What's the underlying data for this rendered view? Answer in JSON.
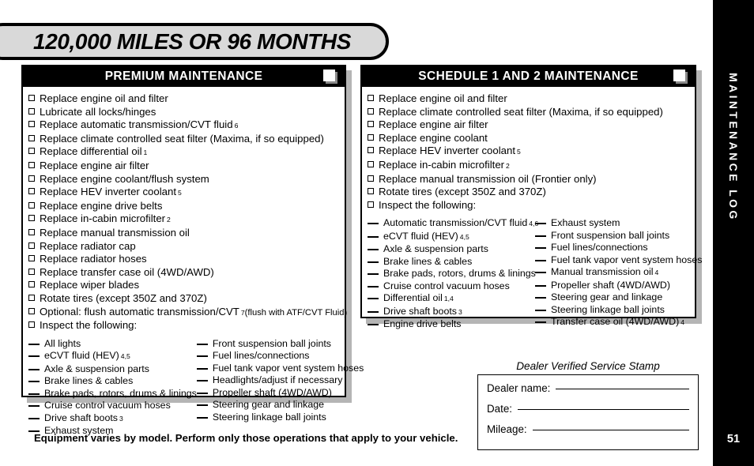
{
  "banner": {
    "title": "120,000 MILES OR 96 MONTHS"
  },
  "side_tab": {
    "label": "MAINTENANCE LOG",
    "page_number": "51"
  },
  "footer": {
    "note": "Equipment varies by model. Perform only those operations that apply to your vehicle."
  },
  "panels": {
    "premium": {
      "header": "PREMIUM MAINTENANCE",
      "icon": "page-icon",
      "items": [
        {
          "text": "Replace engine oil and filter"
        },
        {
          "text": "Lubricate all locks/hinges"
        },
        {
          "text": "Replace automatic transmission/CVT fluid",
          "sup": "6"
        },
        {
          "text": "Replace climate controlled seat filter (Maxima, if so equipped)"
        },
        {
          "text": "Replace differential oil",
          "sup": "1"
        },
        {
          "text": "Replace engine air filter"
        },
        {
          "text": "Replace engine coolant/flush system"
        },
        {
          "text": "Replace HEV inverter coolant",
          "sup": "5"
        },
        {
          "text": "Replace engine drive belts"
        },
        {
          "text": "Replace in-cabin microfilter",
          "sup": "2"
        },
        {
          "text": "Replace manual transmission oil"
        },
        {
          "text": "Replace radiator cap"
        },
        {
          "text": "Replace radiator hoses"
        },
        {
          "text": "Replace transfer case oil (4WD/AWD)"
        },
        {
          "text": "Replace wiper blades"
        },
        {
          "text": "Rotate tires (except 350Z and 370Z)"
        },
        {
          "text": "Optional: flush automatic transmission/CVT",
          "sup": "7",
          "note": "(flush with ATF/CVT Fluid)"
        },
        {
          "text": "Inspect the following:"
        }
      ],
      "inspect_col_1": [
        {
          "text": "All lights"
        },
        {
          "text": "eCVT fluid (HEV)",
          "sup": "4,5"
        },
        {
          "text": "Axle & suspension parts"
        },
        {
          "text": "Brake lines & cables"
        },
        {
          "text": "Brake pads, rotors, drums & linings"
        },
        {
          "text": "Cruise control vacuum hoses"
        },
        {
          "text": "Drive shaft boots",
          "sup": "3"
        },
        {
          "text": "Exhaust system"
        }
      ],
      "inspect_col_2": [
        {
          "text": "Front suspension ball joints"
        },
        {
          "text": "Fuel lines/connections"
        },
        {
          "text": "Fuel tank vapor vent system hoses"
        },
        {
          "text": "Headlights/adjust if necessary"
        },
        {
          "text": "Propeller shaft (4WD/AWD)"
        },
        {
          "text": "Steering gear and linkage"
        },
        {
          "text": "Steering linkage ball joints"
        }
      ]
    },
    "schedule": {
      "header": "SCHEDULE 1 AND 2 MAINTENANCE",
      "icon": "page-icon",
      "items": [
        {
          "text": "Replace engine oil and filter"
        },
        {
          "text": "Replace climate controlled seat filter (Maxima, if so equipped)"
        },
        {
          "text": "Replace engine air filter"
        },
        {
          "text": "Replace engine coolant"
        },
        {
          "text": "Replace HEV inverter coolant",
          "sup": "5"
        },
        {
          "text": "Replace in-cabin microfilter",
          "sup": "2"
        },
        {
          "text": "Replace manual transmission oil (Frontier only)"
        },
        {
          "text": "Rotate tires (except 350Z and 370Z)"
        },
        {
          "text": "Inspect the following:"
        }
      ],
      "inspect_col_1": [
        {
          "text": "Automatic transmission/CVT fluid",
          "sup": "4,6"
        },
        {
          "text": "eCVT fluid (HEV)",
          "sup": "4,5"
        },
        {
          "text": "Axle & suspension parts"
        },
        {
          "text": "Brake lines & cables"
        },
        {
          "text": "Brake pads, rotors, drums & linings"
        },
        {
          "text": "Cruise control vacuum hoses"
        },
        {
          "text": "Differential oil",
          "sup": "1,4"
        },
        {
          "text": "Drive shaft boots",
          "sup": "3"
        },
        {
          "text": "Engine drive belts"
        }
      ],
      "inspect_col_2": [
        {
          "text": "Exhaust system"
        },
        {
          "text": "Front suspension ball joints"
        },
        {
          "text": "Fuel lines/connections"
        },
        {
          "text": "Fuel tank vapor vent system hoses"
        },
        {
          "text": "Manual transmission oil",
          "sup": "4"
        },
        {
          "text": "Propeller shaft (4WD/AWD)"
        },
        {
          "text": "Steering gear and linkage"
        },
        {
          "text": "Steering linkage ball joints"
        },
        {
          "text": "Transfer case oil (4WD/AWD)",
          "sup": "4"
        }
      ]
    }
  },
  "dealer_stamp": {
    "caption": "Dealer Verified Service Stamp",
    "fields": [
      {
        "label": "Dealer name:",
        "value": ""
      },
      {
        "label": "Date:",
        "value": ""
      },
      {
        "label": "Mileage:",
        "value": ""
      }
    ]
  }
}
